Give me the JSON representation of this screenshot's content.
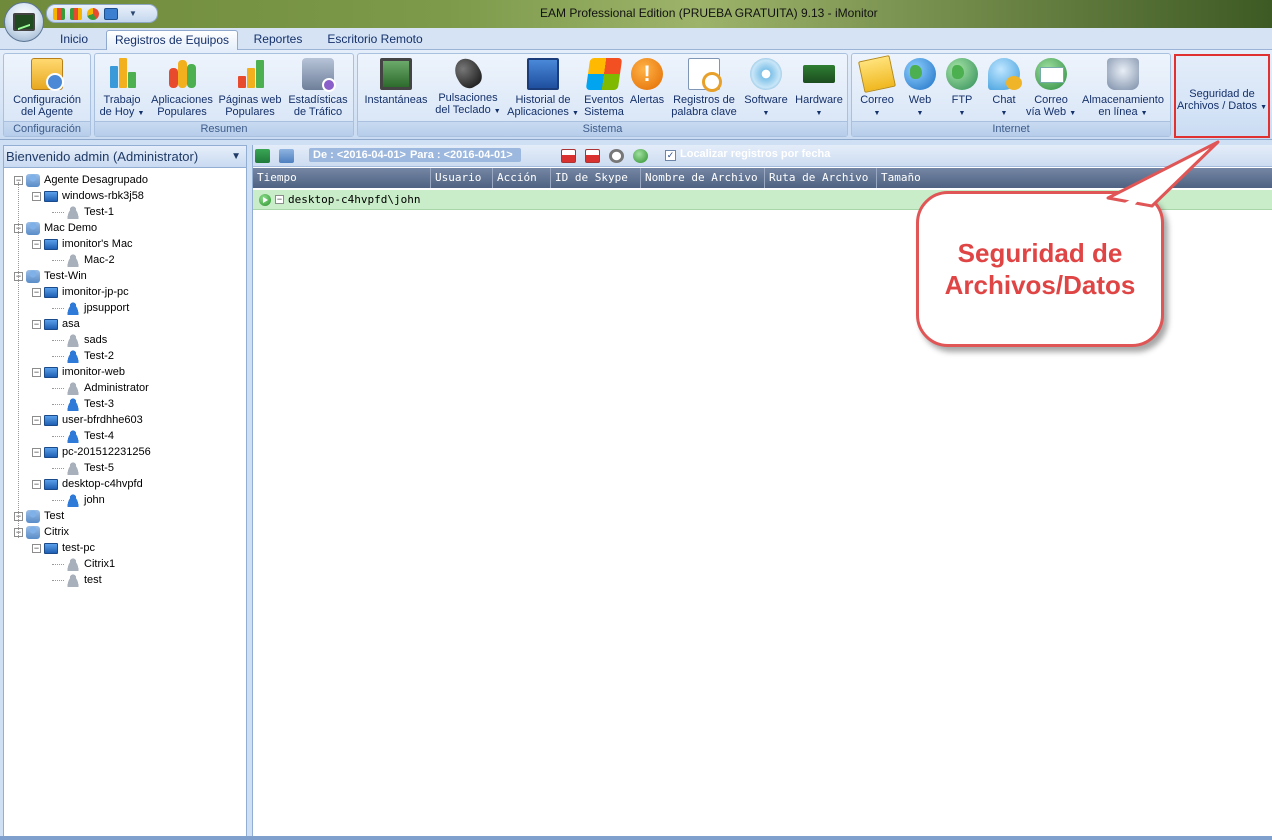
{
  "window": {
    "title": "EAM Professional Edition (PRUEBA GRATUITA) 9.13 - iMonitor"
  },
  "tabs": [
    {
      "label": "Inicio"
    },
    {
      "label": "Registros de Equipos"
    },
    {
      "label": "Reportes"
    },
    {
      "label": "Escritorio Remoto"
    }
  ],
  "ribbon": {
    "groups": {
      "configuracion": "Configuración",
      "resumen": "Resumen",
      "sistema": "Sistema",
      "internet": "Internet"
    },
    "buttons": {
      "config_agent": [
        "Configuración",
        "del Agente"
      ],
      "trabajo": [
        "Trabajo",
        "de Hoy"
      ],
      "aplicaciones": [
        "Aplicaciones",
        "Populares"
      ],
      "paginas": [
        "Páginas web",
        "Populares"
      ],
      "estadisticas": [
        "Estadísticas",
        "de Tráfico"
      ],
      "instantaneas": [
        "Instantáneas",
        ""
      ],
      "pulsaciones": [
        "Pulsaciones",
        "del Teclado"
      ],
      "historial": [
        "Historial de",
        "Aplicaciones"
      ],
      "eventos": [
        "Eventos",
        "Sistema"
      ],
      "alertas": [
        "Alertas",
        ""
      ],
      "registros": [
        "Registros de",
        "palabra clave"
      ],
      "software": [
        "Software",
        ""
      ],
      "hardware": [
        "Hardware",
        ""
      ],
      "correo": [
        "Correo",
        ""
      ],
      "web": [
        "Web",
        ""
      ],
      "ftp": [
        "FTP",
        ""
      ],
      "chat": [
        "Chat",
        ""
      ],
      "correo_web": [
        "Correo",
        "vía Web"
      ],
      "almacenamiento": [
        "Almacenamiento",
        "en línea"
      ],
      "seguridad": [
        "Seguridad de",
        "Archivos / Datos"
      ]
    }
  },
  "left_panel": {
    "header": "Bienvenido admin (Administrator)",
    "tree": [
      {
        "label": "Agente Desagrupado",
        "level": 0,
        "icon": "network-icon"
      },
      {
        "label": "windows-rbk3j58",
        "level": 1,
        "icon": "computer-icon"
      },
      {
        "label": "Test-1",
        "level": 2,
        "icon": "user-offline-icon"
      },
      {
        "label": "Mac Demo",
        "level": 0,
        "icon": "network-icon"
      },
      {
        "label": "imonitor's Mac",
        "level": 1,
        "icon": "computer-icon"
      },
      {
        "label": "Mac-2",
        "level": 2,
        "icon": "user-offline-icon"
      },
      {
        "label": "Test-Win",
        "level": 0,
        "icon": "network-icon"
      },
      {
        "label": "imonitor-jp-pc",
        "level": 1,
        "icon": "computer-icon"
      },
      {
        "label": "jpsupport",
        "level": 2,
        "icon": "user-online-icon"
      },
      {
        "label": "asa",
        "level": 1,
        "icon": "computer-icon"
      },
      {
        "label": "sads",
        "level": 2,
        "icon": "user-offline-icon"
      },
      {
        "label": "Test-2",
        "level": 2,
        "icon": "user-online-icon"
      },
      {
        "label": "imonitor-web",
        "level": 1,
        "icon": "computer-icon"
      },
      {
        "label": "Administrator",
        "level": 2,
        "icon": "user-offline-icon"
      },
      {
        "label": "Test-3",
        "level": 2,
        "icon": "user-online-icon"
      },
      {
        "label": "user-bfrdhhe603",
        "level": 1,
        "icon": "computer-icon"
      },
      {
        "label": "Test-4",
        "level": 2,
        "icon": "user-online-icon"
      },
      {
        "label": "pc-201512231256",
        "level": 1,
        "icon": "computer-icon"
      },
      {
        "label": "Test-5",
        "level": 2,
        "icon": "user-offline-icon"
      },
      {
        "label": "desktop-c4hvpfd",
        "level": 1,
        "icon": "computer-icon"
      },
      {
        "label": "john",
        "level": 2,
        "icon": "user-online-icon"
      },
      {
        "label": "Test",
        "level": 0,
        "icon": "network-icon"
      },
      {
        "label": "Citrix",
        "level": 0,
        "icon": "network-icon"
      },
      {
        "label": "test-pc",
        "level": 1,
        "icon": "computer-icon"
      },
      {
        "label": "Citrix1",
        "level": 2,
        "icon": "user-offline-icon"
      },
      {
        "label": "test",
        "level": 2,
        "icon": "user-offline-icon"
      }
    ]
  },
  "toolbar": {
    "from_label": "De : <2016-04-01>",
    "to_label": "Para : <2016-04-01>",
    "locate_label": "Localizar registros por fecha",
    "locate_checked": "✓"
  },
  "grid": {
    "columns": [
      "Tiempo",
      "Usuario",
      "Acción",
      "ID de Skype",
      "Nombre de Archivo",
      "Ruta de Archivo",
      "Tamaño"
    ],
    "group_row": "desktop-c4hvpfd\\john"
  },
  "callout": {
    "line1": "Seguridad de",
    "line2": "Archivos/Datos"
  },
  "colors": {
    "callout_border": "#e05555",
    "callout_text": "#e04545",
    "group_row_bg": "#c9edc9"
  }
}
